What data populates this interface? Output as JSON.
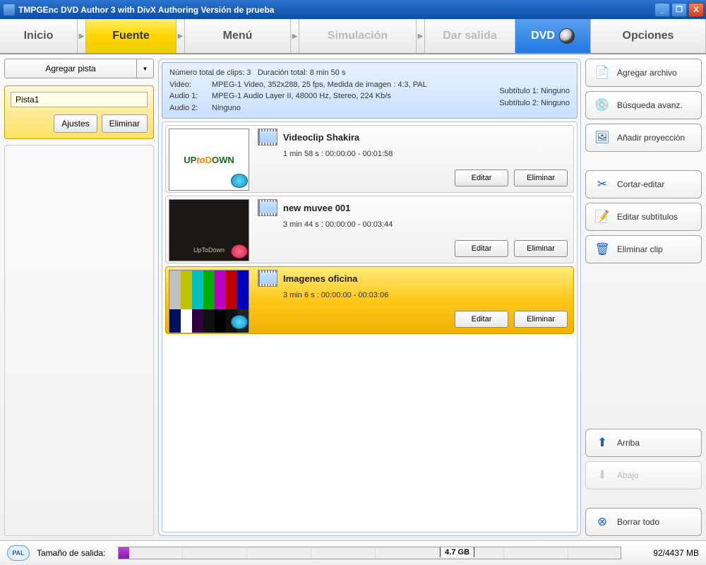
{
  "window": {
    "title": "TMPGEnc DVD Author 3 with DivX Authoring Versión de prueba"
  },
  "steps": {
    "inicio": "Inicio",
    "fuente": "Fuente",
    "menu": "Menú",
    "simulacion": "Simulación",
    "salida": "Dar salida",
    "dvd": "DVD",
    "opciones": "Opciones"
  },
  "left": {
    "add_track": "Agregar pista",
    "track_name": "Pista1",
    "ajustes": "Ajustes",
    "eliminar": "Eliminar"
  },
  "info": {
    "total": "Número total de clips: 3",
    "duracion": "Duración total: 8 min 50 s",
    "video_lab": "Video:",
    "video": "MPEG-1 Video,  352x288,  25 fps,  Medida de imagen : 4:3,  PAL",
    "a1_lab": "Audio 1:",
    "a1": "MPEG-1 Audio Layer II,  48000 Hz,  Stereo,  224 Kb/s",
    "a2_lab": "Audio 2:",
    "a2": "Ninguno",
    "sub1": "Subtítulo 1: Ninguno",
    "sub2": "Subtítulo 2: Ninguno"
  },
  "clips": [
    {
      "title": "Videoclip Shakira",
      "dur": "1 min 58 s :  00:00:00 - 00:01:58",
      "thumb_text": "UPtoDOWN"
    },
    {
      "title": "new muvee 001",
      "dur": "3 min 44 s :  00:00:00 - 00:03:44",
      "thumb_text": "UpToDown"
    },
    {
      "title": "Imagenes oficina",
      "dur": "3 min 6 s :  00:00:00 - 00:03:06"
    }
  ],
  "clip_btn": {
    "edit": "Editar",
    "del": "Eliminar"
  },
  "right": {
    "agregar": "Agregar archivo",
    "busqueda": "Búsqueda avanz.",
    "proyeccion": "Añadir proyección",
    "cortar": "Cortar-editar",
    "subtitulos": "Editar subtítulos",
    "eliminar": "Eliminar clip",
    "arriba": "Arriba",
    "abajo": "Abajo",
    "borrar": "Borrar todo"
  },
  "status": {
    "pal": "PAL",
    "tamano": "Tamaño de salida:",
    "cap": "4.7 GB",
    "mb": "92/4437 MB"
  }
}
